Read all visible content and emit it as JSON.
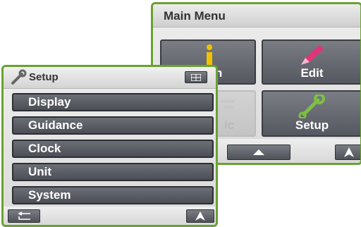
{
  "main_menu": {
    "title": "Main Menu",
    "tiles": {
      "information": "ation",
      "edit": "Edit",
      "traffic": "ic",
      "setup": "Setup"
    }
  },
  "setup_menu": {
    "title": "Setup",
    "items": [
      {
        "label": "Display"
      },
      {
        "label": "Guidance"
      },
      {
        "label": "Clock"
      },
      {
        "label": "Unit"
      },
      {
        "label": "System"
      }
    ]
  },
  "colors": {
    "panel_border": "#6aa132",
    "button_dark": "#555860",
    "info_icon": "#f2c200",
    "edit_icon": "#e0357a",
    "setup_icon": "#7cc142"
  },
  "icons": [
    "info-icon",
    "pencil-icon",
    "wrench-icon",
    "triangle-up-icon",
    "navigation-arrow-icon",
    "back-arrow-icon",
    "grid-icon"
  ]
}
